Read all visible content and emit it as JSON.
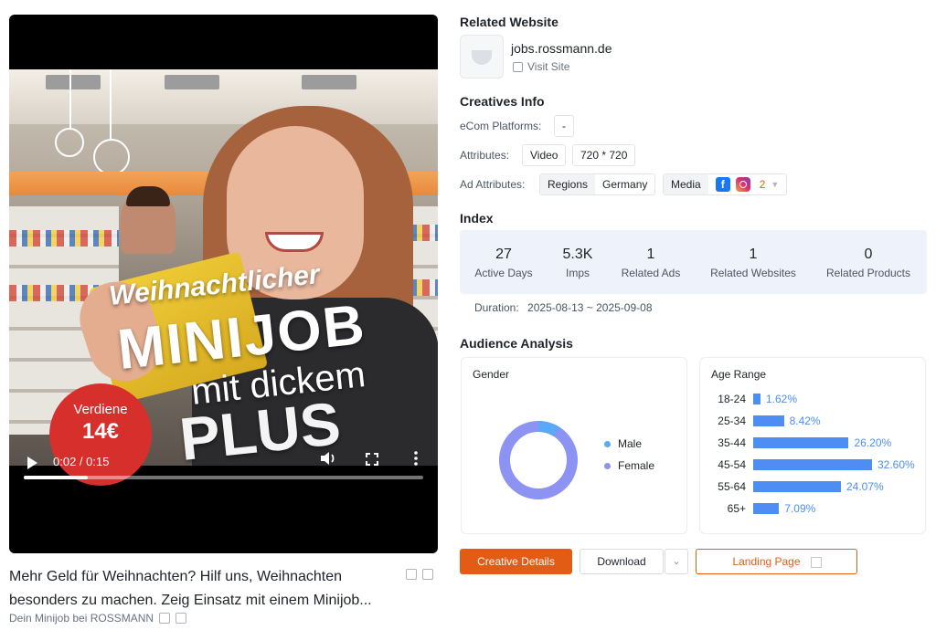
{
  "video": {
    "overlay": {
      "line1": "Weihnachtlicher",
      "line2": "MINIJOB",
      "line3": "mit dickem",
      "line4": "PLUS"
    },
    "badge": {
      "top": "Verdiene",
      "amount": "14€"
    },
    "time": "0:02 / 0:15",
    "progress_fraction": 0.16
  },
  "caption": "Mehr Geld für Weihnachten? Hilf uns, Weihnachten besonders zu machen. Zeig Einsatz mit einem Minijob...",
  "advertiser": "Dein Minijob bei ROSSMANN",
  "related_website": {
    "title": "Related Website",
    "domain": "jobs.rossmann.de",
    "visit_label": "Visit Site"
  },
  "creatives_info": {
    "title": "Creatives Info",
    "ecom_label": "eCom Platforms:",
    "ecom_value": "-",
    "attributes_label": "Attributes:",
    "attributes": [
      "Video",
      "720 * 720"
    ],
    "ad_attributes_label": "Ad Attributes:",
    "regions_label": "Regions",
    "regions_value": "Germany",
    "media_label": "Media",
    "media_more": "2",
    "media_icons": [
      "facebook-icon",
      "instagram-icon"
    ]
  },
  "index": {
    "title": "Index",
    "stats": [
      {
        "value": "27",
        "label": "Active Days"
      },
      {
        "value": "5.3K",
        "label": "Imps"
      },
      {
        "value": "1",
        "label": "Related Ads"
      },
      {
        "value": "1",
        "label": "Related Websites"
      },
      {
        "value": "0",
        "label": "Related Products"
      }
    ],
    "duration_label": "Duration:",
    "duration_value": "2025-08-13 ~ 2025-09-08"
  },
  "audience": {
    "title": "Audience Analysis",
    "gender": {
      "title": "Gender",
      "male_label": "Male",
      "female_label": "Female",
      "male_fraction": 0.09,
      "male_color": "#5aa9f7",
      "female_color": "#8c93f2"
    },
    "age": {
      "title": "Age Range",
      "rows": [
        {
          "label": "18-24",
          "value": "1.62%",
          "pct": 1.62
        },
        {
          "label": "25-34",
          "value": "8.42%",
          "pct": 8.42
        },
        {
          "label": "35-44",
          "value": "26.20%",
          "pct": 26.2
        },
        {
          "label": "45-54",
          "value": "32.60%",
          "pct": 32.6
        },
        {
          "label": "55-64",
          "value": "24.07%",
          "pct": 24.07
        },
        {
          "label": "65+",
          "value": "7.09%",
          "pct": 7.09
        }
      ]
    }
  },
  "actions": {
    "creative_details": "Creative Details",
    "download": "Download",
    "dropdown_glyph": "⌄",
    "landing_page": "Landing Page"
  },
  "colors": {
    "accent": "#e35c16",
    "bar": "#4e8ef2",
    "index_bg": "#eef2fa"
  }
}
